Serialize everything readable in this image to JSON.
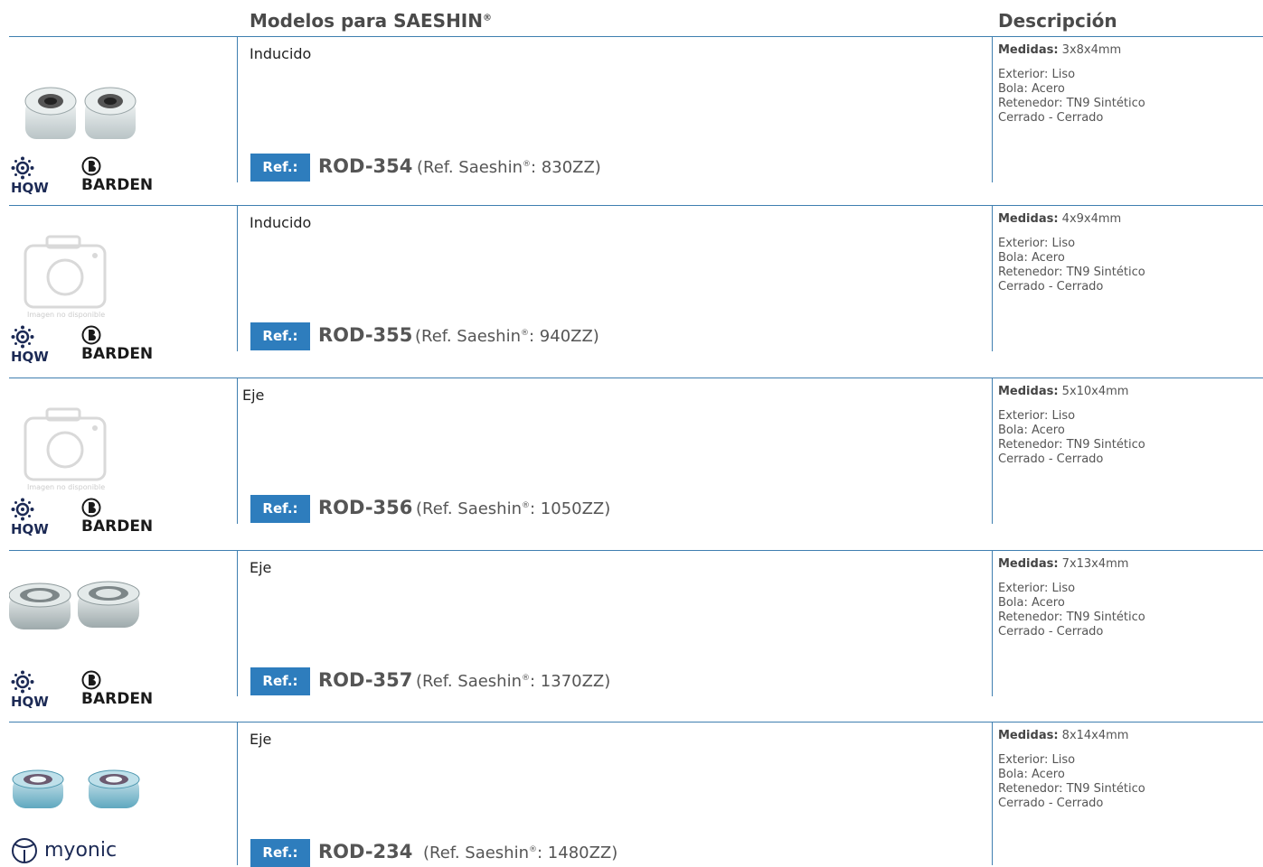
{
  "header": {
    "models_title": "Modelos para SAESHIN",
    "models_mark": "®",
    "description_title": "Descripción"
  },
  "brands": {
    "hqw": "HQW",
    "barden": "BARDEN",
    "myonic": "myonic"
  },
  "no_image_text": "Imagen no disponible",
  "rows": [
    {
      "application": "Inducido",
      "ref_label": "Ref.:",
      "code": "ROD-354",
      "saeshin_prefix": "(Ref. Saeshin",
      "saeshin_mark": "®",
      "saeshin_suffix": ": 830ZZ)",
      "measure_label": "Medidas:",
      "measure": "3x8x4mm",
      "specs": [
        "Exterior: Liso",
        "Bola: Acero",
        "Retenedor: TN9 Sintético",
        "Cerrado - Cerrado"
      ]
    },
    {
      "application": "Inducido",
      "ref_label": "Ref.:",
      "code": "ROD-355",
      "saeshin_prefix": "(Ref. Saeshin",
      "saeshin_mark": "®",
      "saeshin_suffix": ": 940ZZ)",
      "measure_label": "Medidas:",
      "measure": "4x9x4mm",
      "specs": [
        "Exterior: Liso",
        "Bola: Acero",
        "Retenedor: TN9 Sintético",
        "Cerrado - Cerrado"
      ]
    },
    {
      "application": "Eje",
      "ref_label": "Ref.:",
      "code": "ROD-356",
      "saeshin_prefix": "(Ref. Saeshin",
      "saeshin_mark": "®",
      "saeshin_suffix": ": 1050ZZ)",
      "measure_label": "Medidas:",
      "measure": "5x10x4mm",
      "specs": [
        "Exterior: Liso",
        "Bola: Acero",
        "Retenedor: TN9 Sintético",
        "Cerrado - Cerrado"
      ]
    },
    {
      "application": "Eje",
      "ref_label": "Ref.:",
      "code": "ROD-357",
      "saeshin_prefix": "(Ref. Saeshin",
      "saeshin_mark": "®",
      "saeshin_suffix": ": 1370ZZ)",
      "measure_label": "Medidas:",
      "measure": "7x13x4mm",
      "specs": [
        "Exterior: Liso",
        "Bola: Acero",
        "Retenedor: TN9 Sintético",
        "Cerrado - Cerrado"
      ]
    },
    {
      "application": "Eje",
      "ref_label": "Ref.:",
      "code": "ROD-234",
      "saeshin_prefix": "(Ref. Saeshin",
      "saeshin_mark": "®",
      "saeshin_suffix": ": 1480ZZ)",
      "measure_label": "Medidas:",
      "measure": "8x14x4mm",
      "specs": [
        "Exterior: Liso",
        "Bola: Acero",
        "Retenedor: TN9 Sintético",
        "Cerrado - Cerrado"
      ]
    }
  ],
  "colors": {
    "accent": "#2e7dbd",
    "rule": "#3f7fb0",
    "text": "#444444"
  }
}
